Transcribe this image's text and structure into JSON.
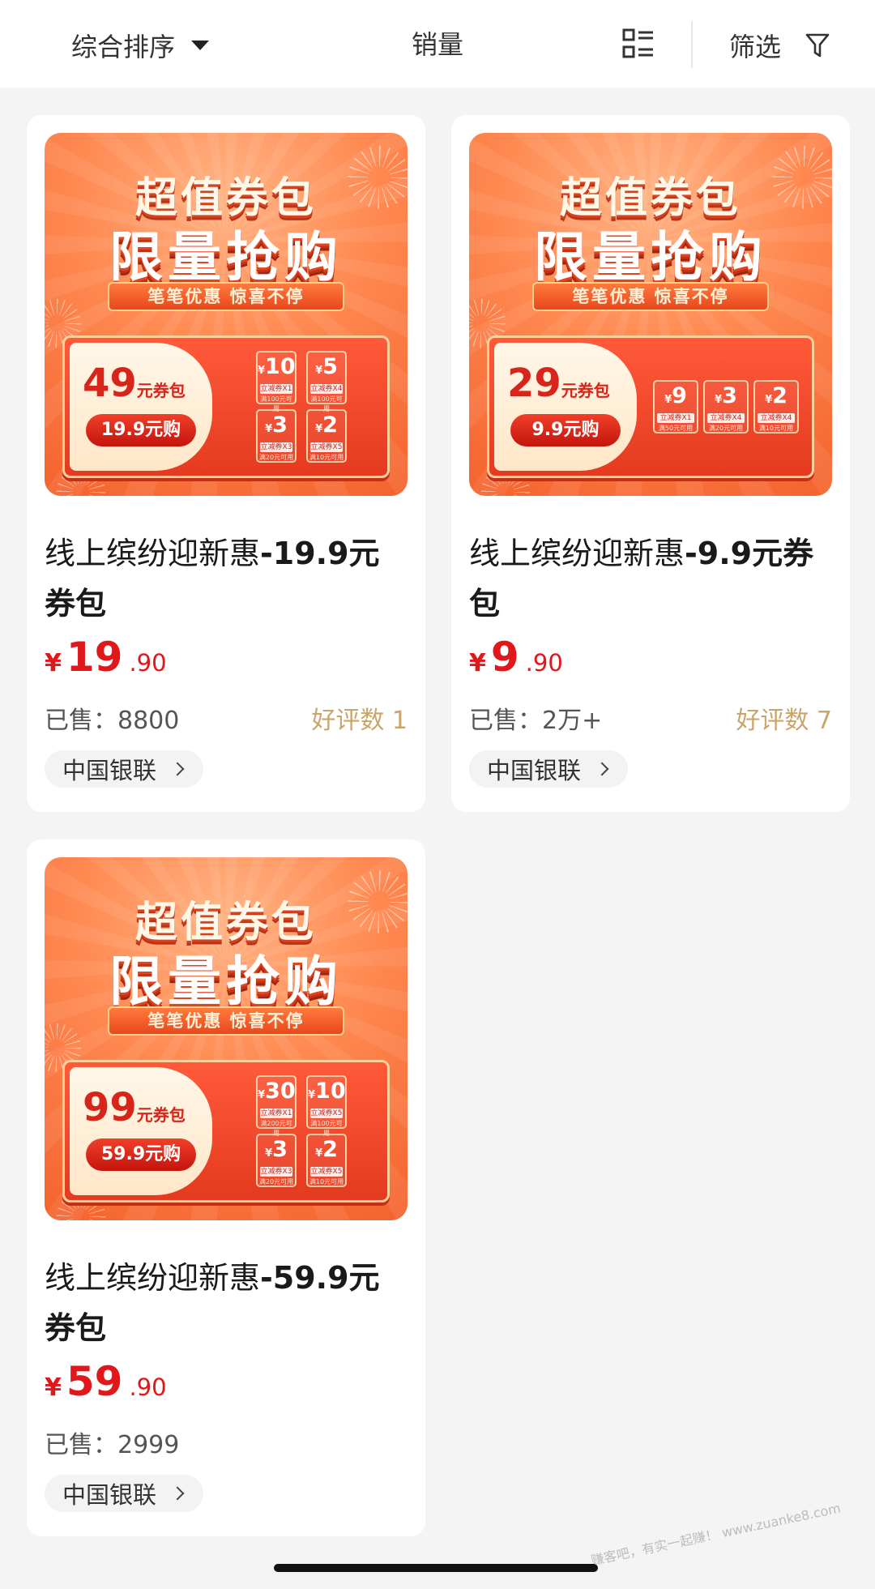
{
  "toolbar": {
    "sort_label": "综合排序",
    "sales_label": "销量",
    "filter_label": "筛选",
    "view_icon": "grid-list-icon",
    "filter_icon": "funnel-icon"
  },
  "colors": {
    "price": "#e0171b",
    "reviews": "#c9a46b",
    "accent": "#f4622d"
  },
  "products": [
    {
      "poster": {
        "headline_top": "超值券包",
        "headline_main": "限量抢购",
        "ribbon": "笔笔优惠 惊喜不停",
        "face_value": "49",
        "face_suffix": "元券包",
        "buy_text": "19.9元购",
        "tiles": [
          {
            "currency": "¥",
            "value": "10",
            "kind": "立减券X1",
            "cond": "满100元可用"
          },
          {
            "currency": "¥",
            "value": "5",
            "kind": "立减券X4",
            "cond": "满100元可用"
          },
          {
            "currency": "¥",
            "value": "3",
            "kind": "立减券X3",
            "cond": "满20元可用"
          },
          {
            "currency": "¥",
            "value": "2",
            "kind": "立减券X5",
            "cond": "满10元可用"
          }
        ]
      },
      "title_text": "线上缤纷迎新惠",
      "title_tail": "-19.9元券包",
      "price_currency": "¥",
      "price_int": "19",
      "price_dec": ".90",
      "sold": "已售：8800",
      "reviews": "好评数 1",
      "merchant": "中国银联"
    },
    {
      "poster": {
        "headline_top": "超值券包",
        "headline_main": "限量抢购",
        "ribbon": "笔笔优惠 惊喜不停",
        "face_value": "29",
        "face_suffix": "元券包",
        "buy_text": "9.9元购",
        "tiles": [
          {
            "currency": "¥",
            "value": "9",
            "kind": "立减券X1",
            "cond": "满50元可用"
          },
          {
            "currency": "¥",
            "value": "3",
            "kind": "立减券X4",
            "cond": "满20元可用"
          },
          {
            "currency": "¥",
            "value": "2",
            "kind": "立减券X4",
            "cond": "满10元可用"
          }
        ]
      },
      "title_text": "线上缤纷迎新惠",
      "title_tail": "-9.9元券包",
      "price_currency": "¥",
      "price_int": "9",
      "price_dec": ".90",
      "sold": "已售：2万+",
      "reviews": "好评数 7",
      "merchant": "中国银联"
    },
    {
      "poster": {
        "headline_top": "超值券包",
        "headline_main": "限量抢购",
        "ribbon": "笔笔优惠 惊喜不停",
        "face_value": "99",
        "face_suffix": "元券包",
        "buy_text": "59.9元购",
        "tiles": [
          {
            "currency": "¥",
            "value": "30",
            "kind": "立减券X1",
            "cond": "满200元可用"
          },
          {
            "currency": "¥",
            "value": "10",
            "kind": "立减券X5",
            "cond": "满100元可用"
          },
          {
            "currency": "¥",
            "value": "3",
            "kind": "立减券X3",
            "cond": "满20元可用"
          },
          {
            "currency": "¥",
            "value": "2",
            "kind": "立减券X5",
            "cond": "满10元可用"
          }
        ]
      },
      "title_text": "线上缤纷迎新惠",
      "title_tail": "-59.9元券包",
      "price_currency": "¥",
      "price_int": "59",
      "price_dec": ".90",
      "sold": "已售：2999",
      "reviews": "",
      "merchant": "中国银联"
    }
  ],
  "watermark": "赚客吧，有实一起赚！ www.zuanke8.com"
}
